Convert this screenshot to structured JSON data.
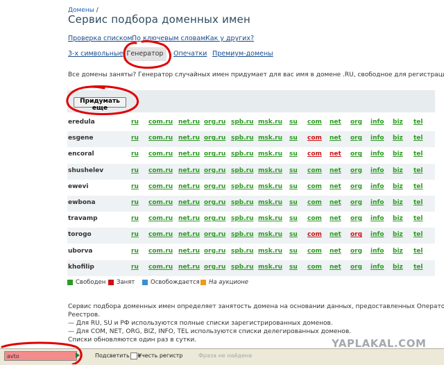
{
  "breadcrumb": {
    "link": "Домены",
    "separator": "/"
  },
  "title": "Сервис подбора доменных имен",
  "nav_links": [
    "Проверка списком",
    "По ключевым словам",
    "Как у других?"
  ],
  "tabs": [
    "3-х символьные",
    "Генератор",
    "Опечатки",
    "Премиум-домены"
  ],
  "active_tab": "Генератор",
  "description": "Все домены заняты? Генератор случайных имен придумает для вас имя в домене .RU, свободное для регистрации.",
  "generate_button": "Придумать еще",
  "tld_columns": [
    "ru",
    "com.ru",
    "net.ru",
    "org.ru",
    "spb.ru",
    "msk.ru",
    "su",
    "com",
    "net",
    "org",
    "info",
    "biz",
    "tel"
  ],
  "domains": [
    {
      "name": "eredula",
      "status": [
        "free",
        "free",
        "free",
        "free",
        "free",
        "free",
        "free",
        "free",
        "free",
        "free",
        "free",
        "free",
        "free"
      ]
    },
    {
      "name": "esgene",
      "status": [
        "free",
        "free",
        "free",
        "free",
        "free",
        "free",
        "free",
        "taken",
        "free",
        "free",
        "free",
        "free",
        "free"
      ]
    },
    {
      "name": "encoral",
      "status": [
        "free",
        "free",
        "free",
        "free",
        "free",
        "free",
        "free",
        "taken",
        "taken",
        "free",
        "free",
        "free",
        "free"
      ]
    },
    {
      "name": "shushelev",
      "status": [
        "free",
        "free",
        "free",
        "free",
        "free",
        "free",
        "free",
        "free",
        "free",
        "free",
        "free",
        "free",
        "free"
      ]
    },
    {
      "name": "ewevi",
      "status": [
        "free",
        "free",
        "free",
        "free",
        "free",
        "free",
        "free",
        "free",
        "free",
        "free",
        "free",
        "free",
        "free"
      ]
    },
    {
      "name": "ewbona",
      "status": [
        "free",
        "free",
        "free",
        "free",
        "free",
        "free",
        "free",
        "free",
        "free",
        "free",
        "free",
        "free",
        "free"
      ]
    },
    {
      "name": "travamp",
      "status": [
        "free",
        "free",
        "free",
        "free",
        "free",
        "free",
        "free",
        "free",
        "free",
        "free",
        "free",
        "free",
        "free"
      ]
    },
    {
      "name": "torogo",
      "status": [
        "free",
        "free",
        "free",
        "free",
        "free",
        "free",
        "free",
        "taken",
        "free",
        "taken",
        "free",
        "free",
        "free"
      ]
    },
    {
      "name": "uborva",
      "status": [
        "free",
        "free",
        "free",
        "free",
        "free",
        "free",
        "free",
        "free",
        "free",
        "free",
        "free",
        "free",
        "free"
      ]
    },
    {
      "name": "khofilip",
      "status": [
        "free",
        "free",
        "free",
        "free",
        "free",
        "free",
        "free",
        "free",
        "free",
        "free",
        "free",
        "free",
        "free"
      ]
    }
  ],
  "status_colors": {
    "free": "#2c9a22",
    "taken": "#cc1111",
    "releasing": "#3a8fd1",
    "auction": "#f09a1a"
  },
  "legend": [
    {
      "key": "free",
      "label": "Свободен"
    },
    {
      "key": "taken",
      "label": "Занят"
    },
    {
      "key": "releasing",
      "label": "Освобождается"
    },
    {
      "key": "auction",
      "label": "На аукционе"
    }
  ],
  "info_lines": [
    "Сервис подбора доменных имен определяет занятость домена на основании данных, предоставленных Операторами",
    "Реестров.",
    "— Для RU, SU и РФ используются полные списки зарегистрированных доменов.",
    "— Для COM, NET, ORG, BIZ, INFO, TEL используются списки делегированных доменов.",
    "Списки обновляются один раз в сутки."
  ],
  "watermark": "YAPLAKAL.COM",
  "findbar": {
    "query": "avto",
    "highlight_all": "Подсветить все",
    "match_case": "Учесть регистр",
    "status": "Фраза не найдена"
  },
  "annotation_color": "#e00000"
}
